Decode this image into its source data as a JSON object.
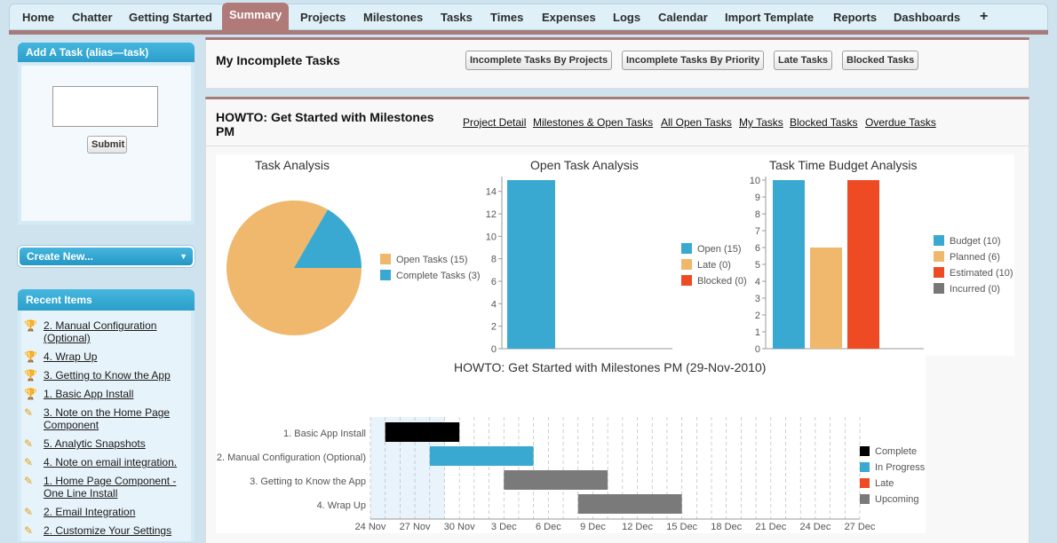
{
  "tabs": [
    {
      "label": "Home"
    },
    {
      "label": "Chatter"
    },
    {
      "label": "Getting Started"
    },
    {
      "label": "Summary"
    },
    {
      "label": "Projects"
    },
    {
      "label": "Milestones"
    },
    {
      "label": "Tasks"
    },
    {
      "label": "Times"
    },
    {
      "label": "Expenses"
    },
    {
      "label": "Logs"
    },
    {
      "label": "Calendar"
    },
    {
      "label": "Import Template"
    },
    {
      "label": "Reports"
    },
    {
      "label": "Dashboards"
    },
    {
      "label": "+"
    }
  ],
  "active_tab": "Summary",
  "sidebar": {
    "add_task_title": "Add A Task (alias—task)",
    "task_input_value": "",
    "submit_label": "Submit",
    "create_new_label": "Create New...",
    "recent_title": "Recent Items",
    "recent_items": [
      {
        "label": "2. Manual Configuration (Optional)",
        "icon": "trophy-icon"
      },
      {
        "label": "4. Wrap Up",
        "icon": "trophy-icon"
      },
      {
        "label": "3. Getting to Know the App",
        "icon": "trophy-icon"
      },
      {
        "label": "1. Basic App Install",
        "icon": "trophy-icon"
      },
      {
        "label": "3. Note on the Home Page Component",
        "icon": "task-icon"
      },
      {
        "label": "5. Analytic Snapshots",
        "icon": "task-icon"
      },
      {
        "label": "4. Note on email integration.",
        "icon": "task-icon"
      },
      {
        "label": "1. Home Page Component - One Line Install",
        "icon": "task-icon"
      },
      {
        "label": "2. Email Integration",
        "icon": "task-icon"
      },
      {
        "label": "2. Customize Your Settings",
        "icon": "task-icon"
      }
    ]
  },
  "incomplete": {
    "title": "My Incomplete Tasks",
    "buttons": [
      "Incomplete Tasks By Projects",
      "Incomplete Tasks By Priority",
      "Late Tasks",
      "Blocked Tasks"
    ]
  },
  "project": {
    "title": "HOWTO: Get Started with Milestones PM",
    "links": [
      "Project Detail",
      "Milestones & Open Tasks",
      "All Open Tasks",
      "My Tasks",
      "Blocked Tasks",
      "Overdue Tasks"
    ]
  },
  "colors": {
    "open": "#3aa9d1",
    "late": "#f0b96e",
    "blocked": "#ee4b24",
    "incurred": "#777777",
    "complete": "#000000",
    "upcoming": "#7a7a7a",
    "gantt_late": "#ee4b24"
  },
  "chart_data": [
    {
      "type": "pie",
      "title": "Task Analysis",
      "slices": [
        {
          "name": "Open Tasks",
          "value": 15,
          "legend": "Open Tasks (15)",
          "color": "#efb86c"
        },
        {
          "name": "Complete Tasks",
          "value": 3,
          "legend": "Complete Tasks (3)",
          "color": "#3aa9d1"
        }
      ]
    },
    {
      "type": "bar",
      "title": "Open Task Analysis",
      "categories": [
        "Open",
        "Late",
        "Blocked"
      ],
      "values": [
        15,
        0,
        0
      ],
      "legend": [
        "Open (15)",
        "Late (0)",
        "Blocked (0)"
      ],
      "colors": [
        "#3aa9d1",
        "#efb86c",
        "#ee4b24"
      ],
      "ylim": [
        0,
        15
      ],
      "yticks": [
        0,
        2,
        4,
        6,
        8,
        10,
        12,
        14
      ]
    },
    {
      "type": "bar",
      "title": "Task Time Budget Analysis",
      "categories": [
        "Budget",
        "Planned",
        "Estimated",
        "Incurred"
      ],
      "values": [
        10,
        6,
        10,
        0
      ],
      "legend": [
        "Budget (10)",
        "Planned (6)",
        "Estimated (10)",
        "Incurred (0)"
      ],
      "colors": [
        "#3aa9d1",
        "#efb86c",
        "#ee4b24",
        "#777777"
      ],
      "ylim": [
        0,
        10
      ],
      "yticks": [
        0,
        1,
        2,
        3,
        4,
        5,
        6,
        7,
        8,
        9,
        10
      ]
    },
    {
      "type": "gantt",
      "title": "HOWTO: Get Started with Milestones PM (29-Nov-2010)",
      "tasks": [
        {
          "label": "1. Basic App Install",
          "start": "2010-11-25",
          "end": "2010-11-30",
          "status": "Complete"
        },
        {
          "label": "2. Manual Configuration (Optional)",
          "start": "2010-11-28",
          "end": "2010-12-05",
          "status": "In Progress"
        },
        {
          "label": "3. Getting to Know the App",
          "start": "2010-12-03",
          "end": "2010-12-10",
          "status": "Upcoming"
        },
        {
          "label": "4. Wrap Up",
          "start": "2010-12-08",
          "end": "2010-12-15",
          "status": "Upcoming"
        }
      ],
      "xticks": [
        "24 Nov",
        "27 Nov",
        "30 Nov",
        "3 Dec",
        "6 Dec",
        "9 Dec",
        "12 Dec",
        "15 Dec",
        "18 Dec",
        "21 Dec",
        "24 Dec",
        "27 Dec"
      ],
      "legend": [
        {
          "name": "Complete",
          "color": "#000000"
        },
        {
          "name": "In Progress",
          "color": "#3aa9d1"
        },
        {
          "name": "Late",
          "color": "#ee4b24"
        },
        {
          "name": "Upcoming",
          "color": "#7a7a7a"
        }
      ]
    }
  ]
}
